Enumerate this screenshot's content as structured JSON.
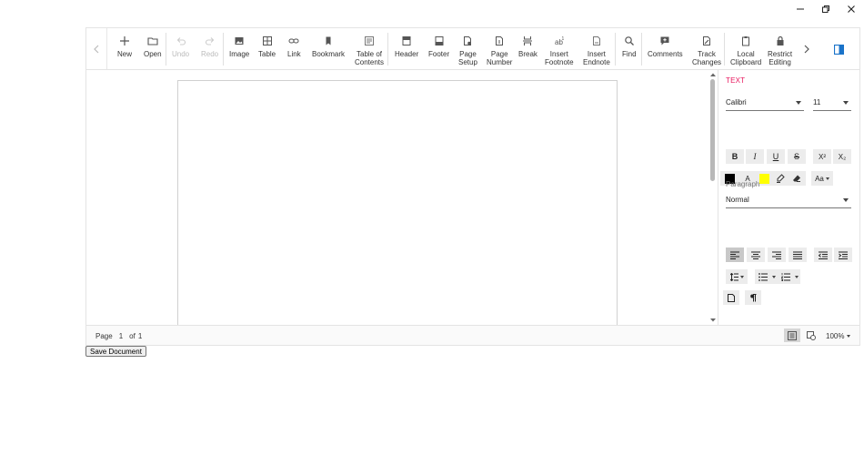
{
  "toolbar": {
    "new": "New",
    "open": "Open",
    "undo": "Undo",
    "redo": "Redo",
    "image": "Image",
    "table": "Table",
    "link": "Link",
    "bookmark": "Bookmark",
    "toc": "Table of\nContents",
    "header": "Header",
    "footer": "Footer",
    "page_setup": "Page\nSetup",
    "page_number": "Page\nNumber",
    "break": "Break",
    "insert_footnote": "Insert\nFootnote",
    "insert_endnote": "Insert\nEndnote",
    "find": "Find",
    "comments": "Comments",
    "track_changes": "Track\nChanges",
    "local_clipboard": "Local\nClipboard",
    "restrict_editing": "Restrict\nEditing"
  },
  "properties": {
    "text_heading": "TEXT",
    "font_family": "Calibri",
    "font_size": "11",
    "bold": "B",
    "italic": "I",
    "underline": "U",
    "strike": "S",
    "superscript": "X²",
    "subscript": "X₂",
    "font_color_label": "A",
    "change_case": "Aa",
    "paragraph_heading": "Paragraph",
    "paragraph_style": "Normal",
    "font_color_value": "#000000",
    "highlight_color": "#ffff00"
  },
  "status": {
    "page_label": "Page",
    "current_page": "1",
    "of_label": "of",
    "total_pages": "1",
    "zoom": "100%"
  },
  "actions": {
    "save_document": "Save Document"
  },
  "colors": {
    "accent": "#e8175d",
    "pane_toggle": "#1a73c9"
  }
}
